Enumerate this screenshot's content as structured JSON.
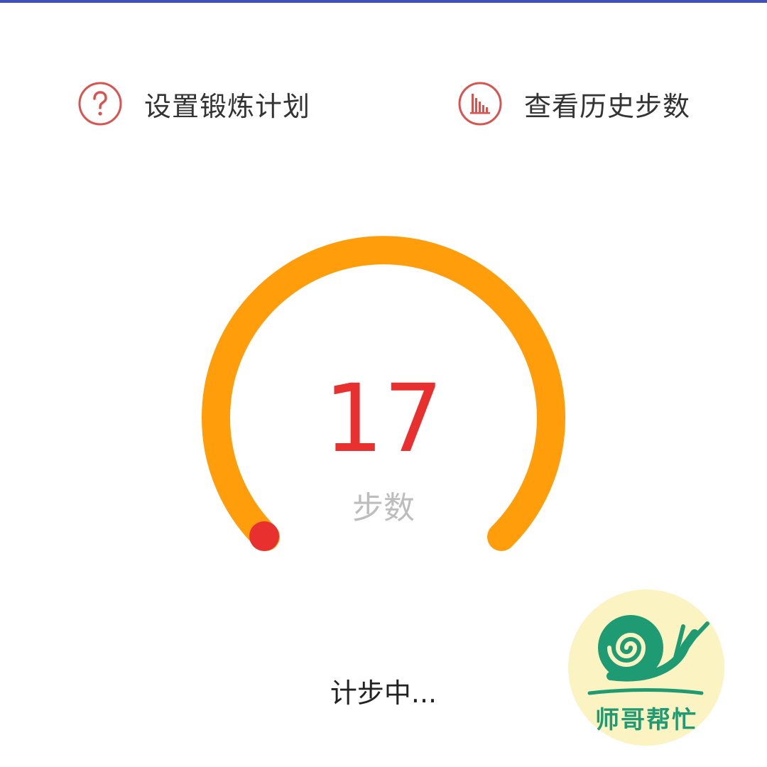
{
  "actions": {
    "plan_label": "设置锻炼计划",
    "history_label": "查看历史步数",
    "plan_icon": "question-circle-icon",
    "history_icon": "bar-chart-circle-icon",
    "icon_color": "#d9534f"
  },
  "counter": {
    "steps": "17",
    "unit": "步数",
    "progress_arc_color": "#ff9d0a",
    "progress_dot_color": "#e8302e",
    "value_color": "#e8302e"
  },
  "status": {
    "text": "计步中..."
  },
  "watermark": {
    "text": "师哥帮忙",
    "icon": "snail-logo-icon",
    "background": "#fbf3c2",
    "brand_color": "#1e9b73"
  },
  "theme": {
    "top_strip_color": "#3f51b5"
  }
}
